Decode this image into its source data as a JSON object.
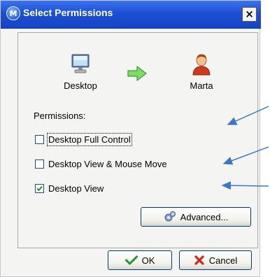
{
  "window": {
    "title": "Select Permissions",
    "close_symbol": "×",
    "logo_letter": "M"
  },
  "source": {
    "label": "Desktop",
    "icon": "computer-monitor-icon"
  },
  "target": {
    "label": "Marta",
    "icon": "user-person-icon"
  },
  "transfer_icon": "arrow-right-icon",
  "permissions": {
    "heading": "Permissions:",
    "items": [
      {
        "label": "Desktop Full Control",
        "checked": false
      },
      {
        "label": "Desktop View & Mouse Move",
        "checked": false
      },
      {
        "label": "Desktop View",
        "checked": true
      }
    ]
  },
  "buttons": {
    "advanced": "Advanced...",
    "ok": "OK",
    "cancel": "Cancel"
  },
  "colors": {
    "title_bar": "#1d4fd2",
    "arrow_green": "#6fd15a",
    "annotation_blue": "#3a78c6",
    "check_green": "#1b9a2c",
    "cancel_red": "#d8231a"
  }
}
